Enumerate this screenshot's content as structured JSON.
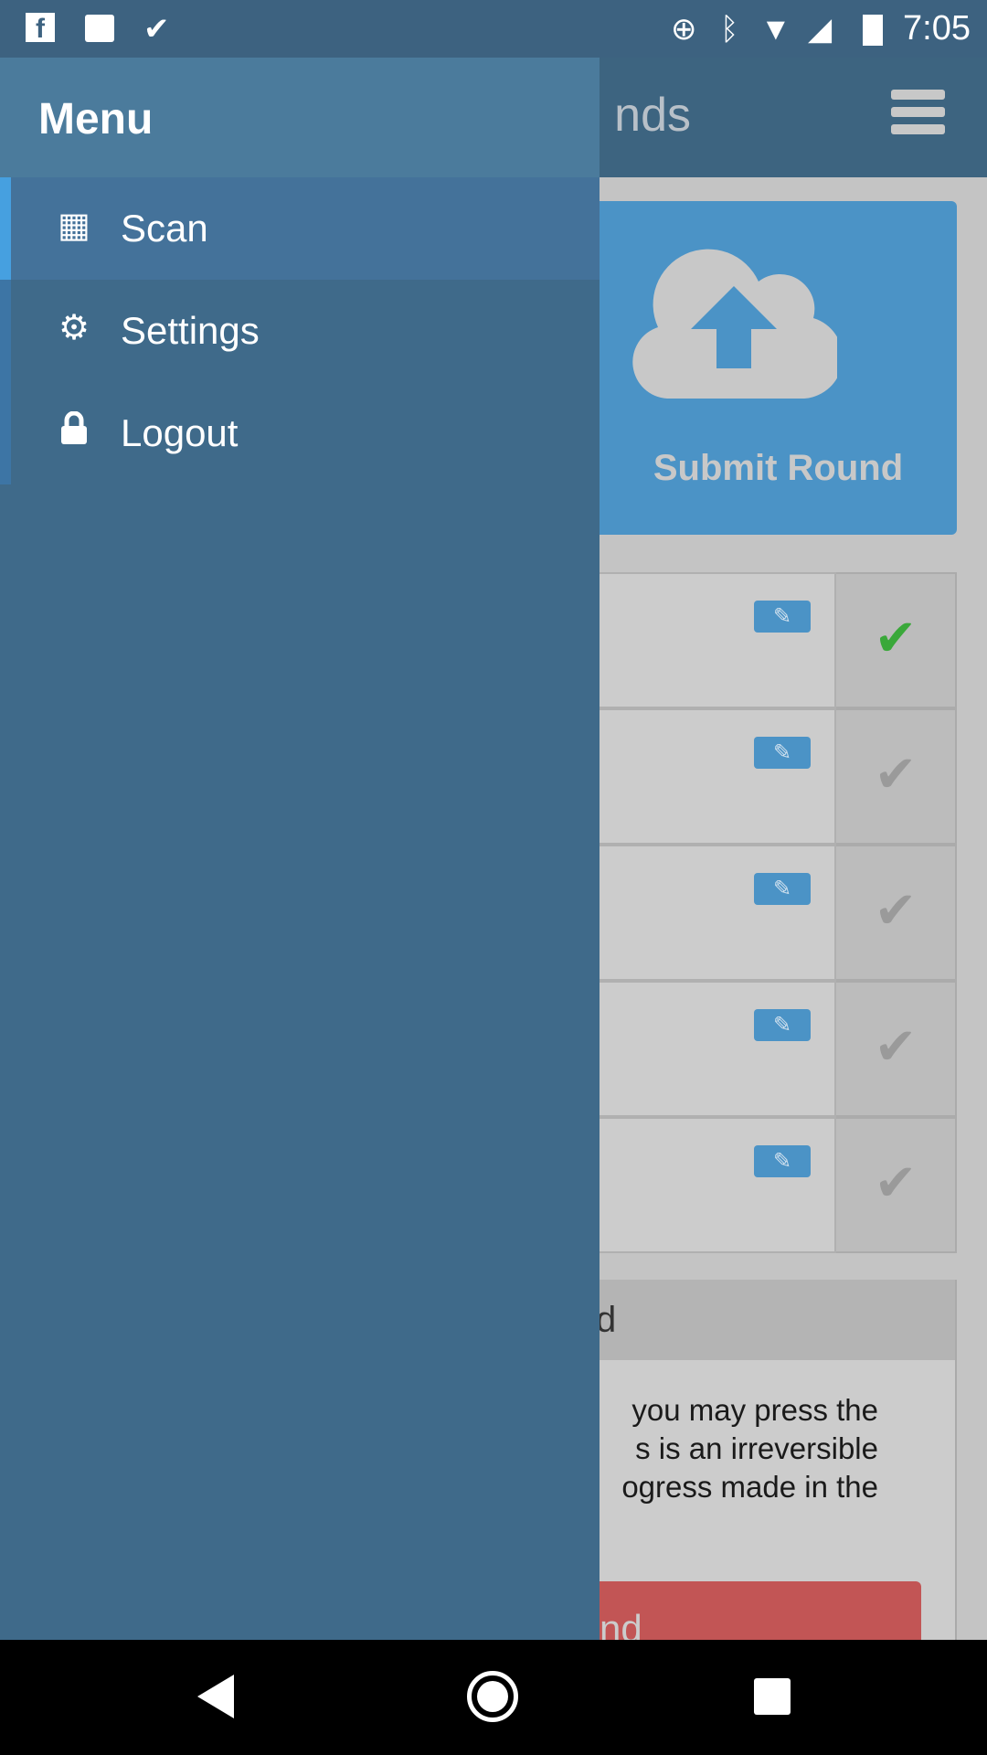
{
  "status_bar": {
    "time": "7:05",
    "left_icons": [
      "facebook-icon",
      "image-icon",
      "checklist-icon"
    ],
    "right_icons": [
      "data-saver-icon",
      "bluetooth-icon",
      "wifi-icon",
      "signal-icon",
      "battery-icon"
    ]
  },
  "app_bar": {
    "title_partial": "nds",
    "menu_icon": "hamburger-icon"
  },
  "submit_card": {
    "label": "Submit Round",
    "icon": "cloud-upload-icon",
    "color": "#4b93c6"
  },
  "rounds": [
    {
      "status": "checked",
      "color": "#3aa83a"
    },
    {
      "status": "unchecked"
    },
    {
      "status": "unchecked"
    },
    {
      "status": "unchecked"
    },
    {
      "status": "unchecked"
    }
  ],
  "panel": {
    "header_partial": "d",
    "body_partial": " you may press the\ns is an irreversible\nogress made in the",
    "button_partial": "nd",
    "button_color": "#c25555"
  },
  "drawer": {
    "title": "Menu",
    "items": [
      {
        "label": "Scan",
        "icon": "qr-code-icon",
        "active": true
      },
      {
        "label": "Settings",
        "icon": "gear-icon"
      },
      {
        "label": "Logout",
        "icon": "lock-icon"
      }
    ]
  },
  "nav_bar": {
    "back": "back-icon",
    "home": "home-icon",
    "recents": "recents-icon"
  }
}
